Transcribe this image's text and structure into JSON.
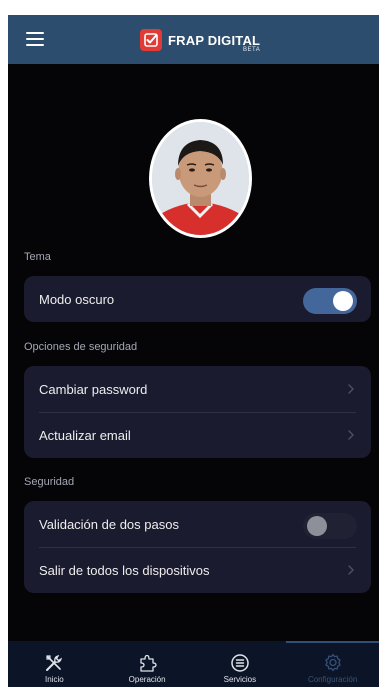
{
  "app": {
    "name": "FRAP DIGITAL",
    "badge": "BETA"
  },
  "sections": {
    "theme": {
      "label": "Tema",
      "dark_mode": {
        "label": "Modo oscuro",
        "enabled": true
      }
    },
    "security_options": {
      "label": "Opciones de seguridad",
      "items": [
        {
          "label": "Cambiar password"
        },
        {
          "label": "Actualizar email"
        }
      ]
    },
    "security": {
      "label": "Seguridad",
      "two_step": {
        "label": "Validación de dos pasos",
        "enabled": false
      },
      "logout_all": {
        "label": "Salir de todos los dispositivos"
      }
    }
  },
  "bottom_nav": [
    {
      "label": "Inicio",
      "icon": "tools-icon"
    },
    {
      "label": "Operación",
      "icon": "puzzle-icon"
    },
    {
      "label": "Servicios",
      "icon": "list-circle-icon"
    },
    {
      "label": "Configuración",
      "icon": "gear-icon",
      "active": true
    }
  ],
  "colors": {
    "header": "#2d4d6e",
    "background": "#050507",
    "card": "#1a1b2e",
    "toggle_on": "#43679b",
    "logo": "#e23a34"
  }
}
